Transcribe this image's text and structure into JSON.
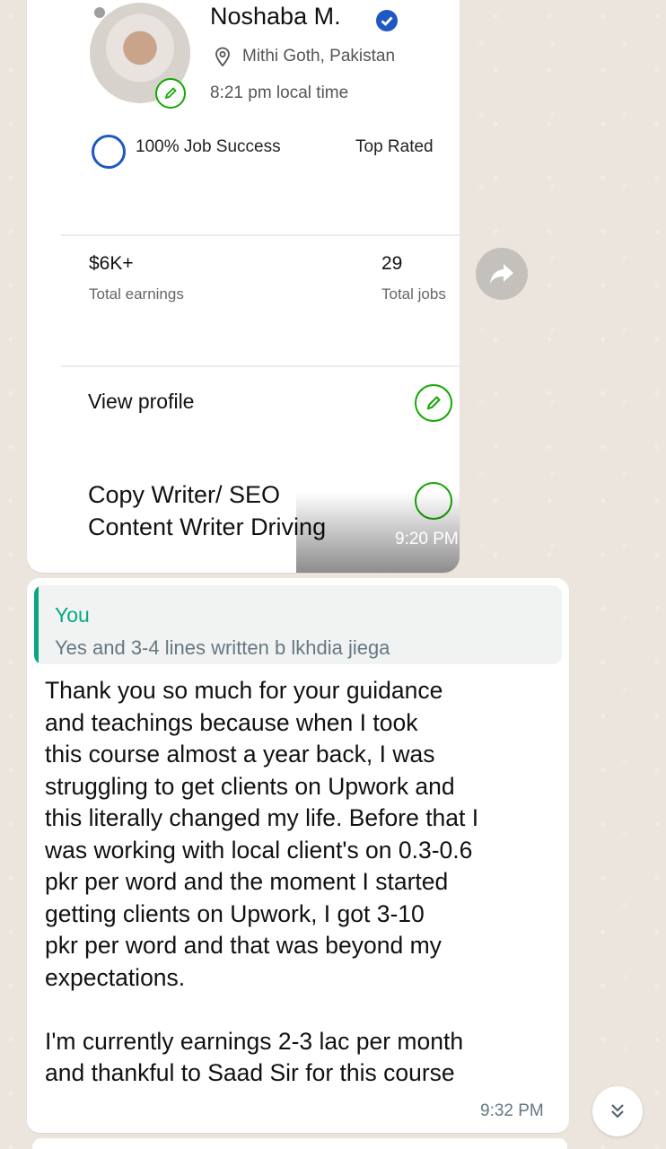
{
  "profile_card": {
    "name": "Noshaba M.",
    "location": "Mithi Goth, Pakistan",
    "local_time": "8:21 pm local time",
    "job_success": "100% Job Success",
    "badge": "Top Rated",
    "earnings_value": "$6K+",
    "earnings_label": "Total earnings",
    "jobs_value": "29",
    "jobs_label": "Total jobs",
    "view_profile": "View profile",
    "title_line1": "Copy Writer/ SEO",
    "title_line2": "Content Writer Driving",
    "time": "9:20 PM"
  },
  "message": {
    "quote_author": "You",
    "quote_text": "Yes and 3-4 lines written b lkhdia jiega",
    "lines": [
      "Thank you so much for your guidance",
      "and teachings because when I took",
      "this course almost a year back, I was",
      "struggling to get clients on Upwork and",
      "this literally changed my life. Before that I",
      "was working with local client's on 0.3-0.6",
      "pkr per word and the moment I started",
      "getting clients on Upwork, I got 3-10",
      "pkr per word and that was beyond my",
      "expectations."
    ],
    "lines2": [
      "I'm currently earnings 2-3 lac per month",
      "and thankful to Saad Sir for this course"
    ],
    "time": "9:32 PM"
  },
  "colors": {
    "chat_bg": "#ece5dd",
    "upwork_green": "#14a800",
    "whatsapp_green": "#06a884",
    "verified_blue": "#1f57c3"
  }
}
